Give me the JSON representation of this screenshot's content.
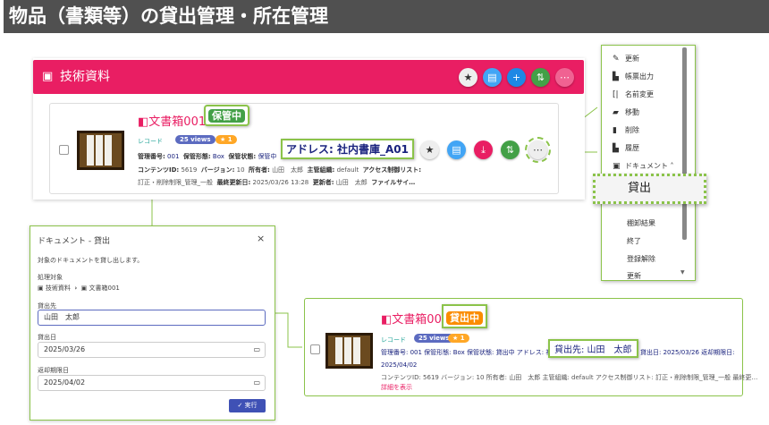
{
  "page_title": "物品（書類等）の貸出管理・所在管理",
  "folder": {
    "name": "技術資料",
    "header_buttons": [
      "star-icon",
      "comment-icon",
      "plus-icon",
      "transfer-icon",
      "more-icon"
    ]
  },
  "record": {
    "title": "文書箱001",
    "status": "保管中",
    "type": "レコード",
    "views": "25 views",
    "stars": "★ 1",
    "address_callout": "アドレス: 社内書庫_A01",
    "line1": [
      [
        "管理番号:",
        "001"
      ],
      [
        "保管形態:",
        "Box"
      ],
      [
        "保管状態:",
        "保管中"
      ]
    ],
    "line2": [
      [
        "コンテンツID:",
        "5619"
      ],
      [
        "バージョン:",
        "10"
      ],
      [
        "所有者:",
        "山田　太郎"
      ],
      [
        "主管組織:",
        "default"
      ],
      [
        "アクセス制御リスト:",
        ""
      ]
    ],
    "line3": [
      [
        "",
        "訂正・削除制限_管理_一般"
      ],
      [
        "最終更新日:",
        "2025/03/26 13:28"
      ],
      [
        "更新者:",
        "山田　太郎"
      ],
      [
        "ファイルサイ…",
        ""
      ]
    ]
  },
  "menu": {
    "items": [
      "更新",
      "帳票出力",
      "名前変更",
      "移動",
      "削除",
      "履歴",
      "ドキュメント"
    ],
    "sub_items": [
      "棚卸結果",
      "終了",
      "登録解除",
      "更新"
    ],
    "highlight": "貸出"
  },
  "dialog": {
    "title": "ドキュメント - 貸出",
    "close": "×",
    "description": "対象のドキュメントを貸し出します。",
    "target_label": "処理対象",
    "target_path": [
      "技術資料",
      "文書箱001"
    ],
    "borrower_label": "貸出先",
    "borrower_value": "山田　太郎",
    "lend_date_label": "貸出日",
    "lend_date_value": "2025/03/26",
    "due_date_label": "返却期限日",
    "due_date_value": "2025/04/02",
    "execute": "✓ 実行"
  },
  "result": {
    "title": "文書箱001",
    "status": "貸出中",
    "type": "レコード",
    "views": "25 views",
    "stars": "★ 1",
    "line1": "管理番号: 001  保管形態: Box  保管状態: 貸出中  アドレス: 社",
    "borrower_callout": "貸出先: 山田　太郎",
    "line1b": "貸出日: 2025/03/26  返却期限日:",
    "line2": "2025/04/02",
    "line3": "コンテンツID: 5619  バージョン: 10  所有者: 山田　太郎  主管組織: default  アクセス制御リスト: 訂正・削除制限_管理_一般  最終更…",
    "details_link": "詳細を表示"
  },
  "colors": {
    "brand": "#e91e63",
    "callout": "#8bc34a",
    "status_stored": "#43a047",
    "status_lent": "#fb8c00",
    "views": "#5c6bc0",
    "primary": "#3f51b5"
  }
}
